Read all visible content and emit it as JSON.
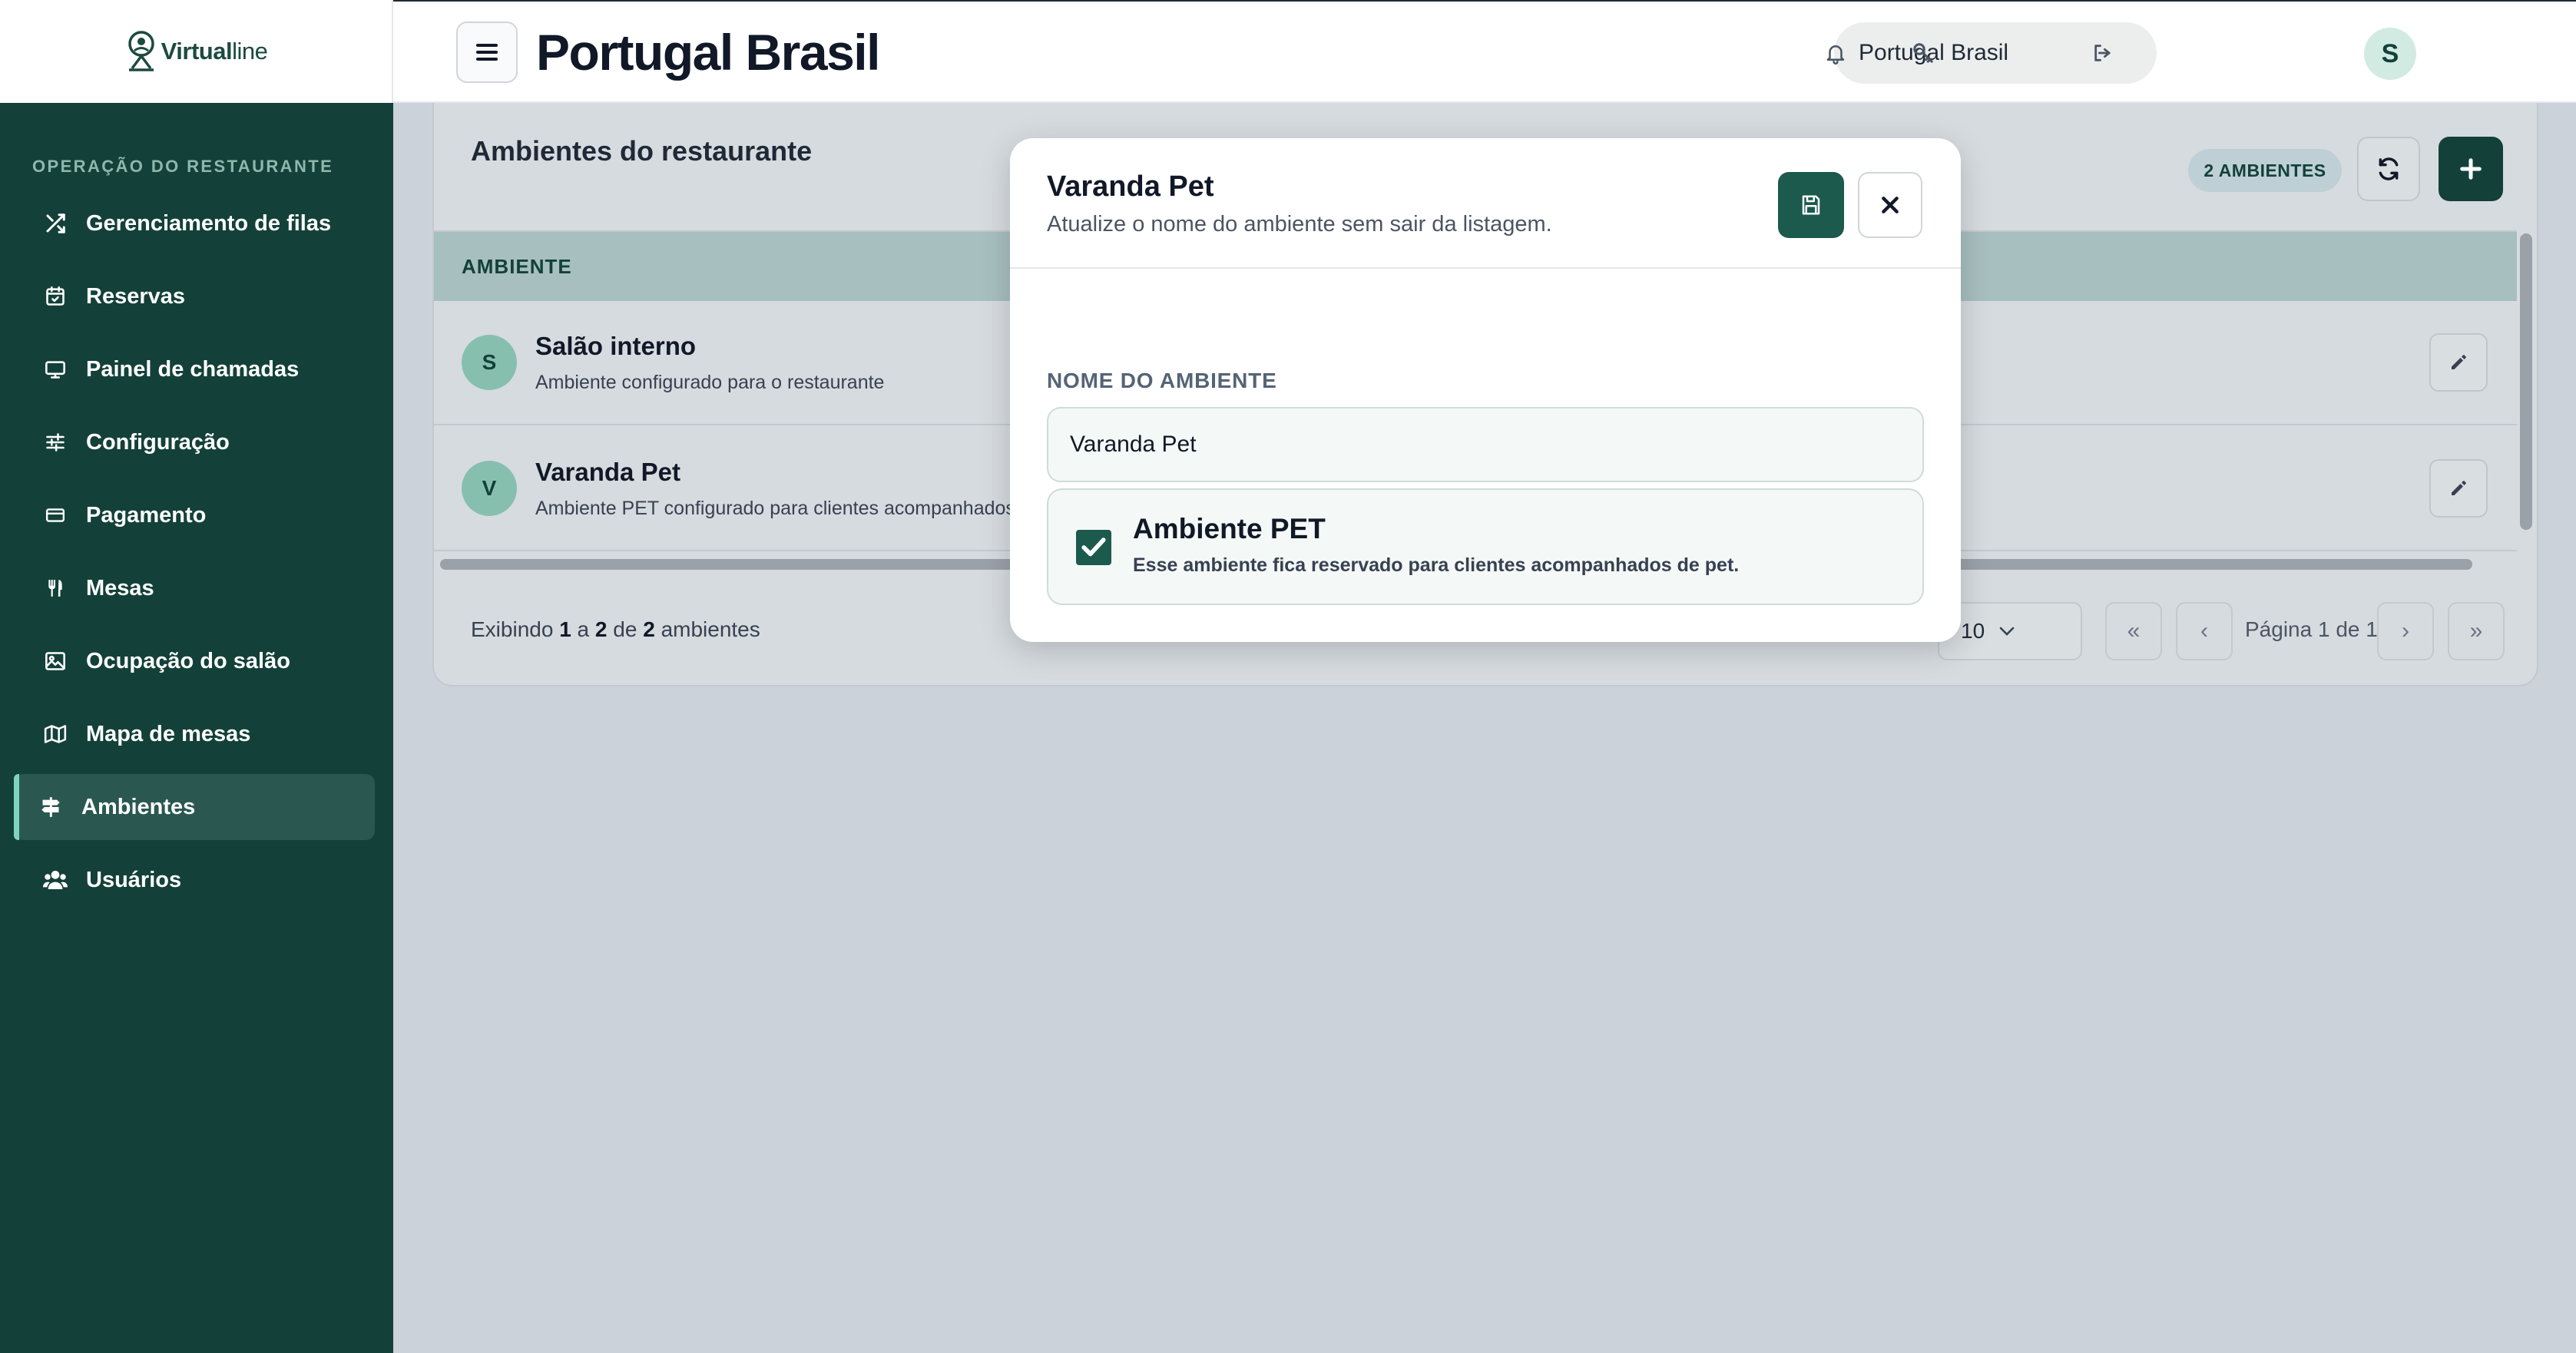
{
  "app": {
    "logo_prefix": "Virtual",
    "logo_suffix": "line"
  },
  "sidebar": {
    "section_label": "OPERAÇÃO DO RESTAURANTE",
    "items": [
      {
        "label": "Gerenciamento de filas",
        "icon": "shuffle-icon"
      },
      {
        "label": "Reservas",
        "icon": "calendar-icon"
      },
      {
        "label": "Painel de chamadas",
        "icon": "monitor-icon"
      },
      {
        "label": "Configuração",
        "icon": "sliders-icon"
      },
      {
        "label": "Pagamento",
        "icon": "credit-card-icon"
      },
      {
        "label": "Mesas",
        "icon": "utensils-icon"
      },
      {
        "label": "Ocupação do salão",
        "icon": "image-icon"
      },
      {
        "label": "Mapa de mesas",
        "icon": "map-icon"
      },
      {
        "label": "Ambientes",
        "icon": "signpost-icon",
        "active": true
      },
      {
        "label": "Usuários",
        "icon": "users-icon"
      }
    ]
  },
  "header": {
    "title": "Portugal Brasil",
    "restaurant_selector": "Portugal Brasil",
    "user_initial": "S"
  },
  "main": {
    "card_title": "Ambientes do restaurante",
    "count_badge": "2 AMBIENTES",
    "table": {
      "column_header": "AMBIENTE",
      "rows": [
        {
          "initial": "S",
          "name": "Salão interno",
          "description": "Ambiente configurado para o restaurante"
        },
        {
          "initial": "V",
          "name": "Varanda Pet",
          "description": "Ambiente PET configurado para clientes acompanhados de pet."
        }
      ]
    },
    "footer": {
      "prefix": "Exibindo",
      "from": "1",
      "sep1": "a",
      "to": "2",
      "sep2": "de",
      "total": "2",
      "suffix": "ambientes"
    },
    "pagination": {
      "page_size": "10",
      "first": "«",
      "prev": "‹",
      "label": "Página 1 de 1",
      "next": "›",
      "last": "»"
    }
  },
  "modal": {
    "title": "Varanda Pet",
    "subtitle": "Atualize o nome do ambiente sem sair da listagem.",
    "field_label": "NOME DO AMBIENTE",
    "field_value": "Varanda Pet",
    "pet_title": "Ambiente PET",
    "pet_description": "Esse ambiente fica reservado para clientes acompanhados de pet.",
    "pet_checked": true
  },
  "colors": {
    "brand_dark": "#134139",
    "accent_green": "#1b5a4d",
    "avatar_bg": "#87bfae"
  }
}
